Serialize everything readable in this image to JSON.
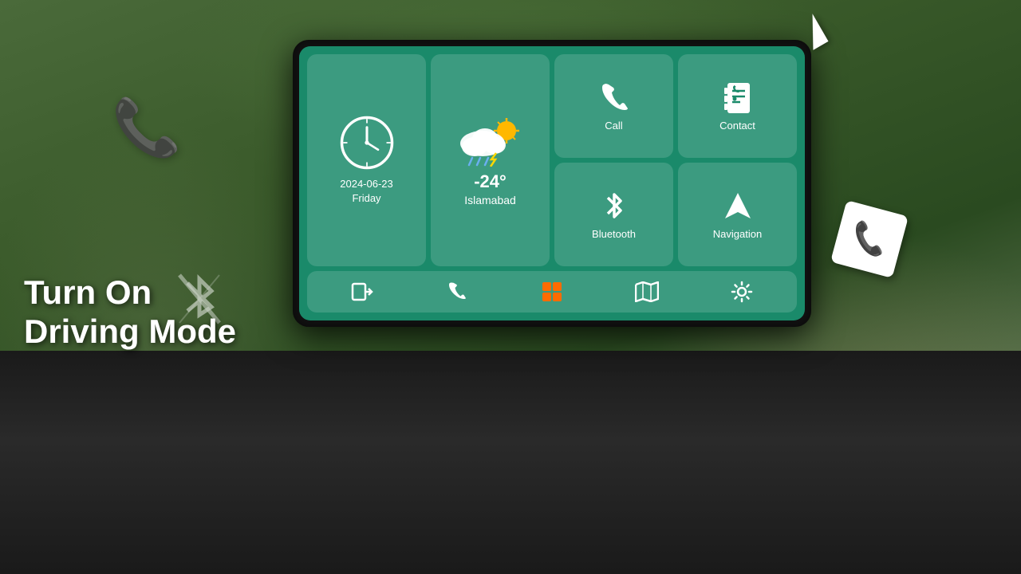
{
  "background": {
    "color": "#3a5a30"
  },
  "screen": {
    "tiles": {
      "clock": {
        "date": "2024-06-23",
        "day": "Friday"
      },
      "weather": {
        "temperature": "-24°",
        "city": "Islamabad"
      },
      "call": {
        "label": "Call"
      },
      "contact": {
        "label": "Contact"
      },
      "bluetooth": {
        "label": "Bluetooth"
      },
      "navigation": {
        "label": "Navigation"
      }
    },
    "bottomNav": {
      "items": [
        "exit",
        "phone",
        "apps",
        "map",
        "settings"
      ]
    }
  },
  "overlay": {
    "line1": "Turn On",
    "line2": "Driving Mode"
  }
}
